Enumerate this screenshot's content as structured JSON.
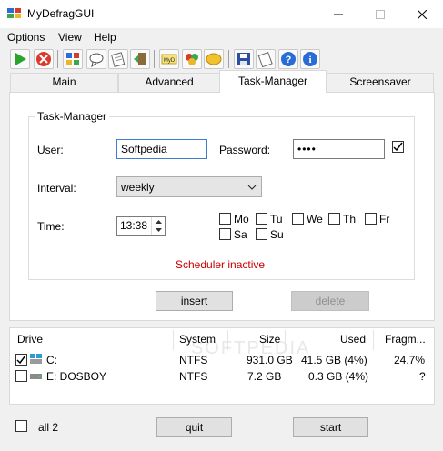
{
  "window": {
    "title": "MyDefragGUI"
  },
  "menu": {
    "items": [
      "Options",
      "View",
      "Help"
    ]
  },
  "tabs": [
    {
      "label": "Main"
    },
    {
      "label": "Advanced"
    },
    {
      "label": "Task-Manager",
      "active": true
    },
    {
      "label": "Screensaver"
    }
  ],
  "task_manager": {
    "group_label": "Task-Manager",
    "user_label": "User:",
    "user_value": "Softpedia",
    "password_label": "Password:",
    "password_value": "••••",
    "password_checked": true,
    "interval_label": "Interval:",
    "interval_value": "weekly",
    "time_label": "Time:",
    "time_value": "13:38",
    "days": [
      "Mo",
      "Tu",
      "We",
      "Th",
      "Fr",
      "Sa",
      "Su"
    ],
    "status": "Scheduler inactive",
    "status_color": "#cc0000",
    "insert_label": "insert",
    "delete_label": "delete"
  },
  "drives": {
    "columns": [
      "Drive",
      "System",
      "Size",
      "Used",
      "Fragm..."
    ],
    "rows": [
      {
        "checked": true,
        "name": "C:",
        "system": "NTFS",
        "size": "931.0 GB",
        "used": "41.5 GB (4%)",
        "fragm": "24.7%"
      },
      {
        "checked": false,
        "name": "E: DOSBOY",
        "system": "NTFS",
        "size": "7.2 GB",
        "used": "0.3 GB (4%)",
        "fragm": "?"
      }
    ],
    "watermark": "SOFTPEDIA"
  },
  "footer": {
    "all_label": "all 2",
    "quit_label": "quit",
    "start_label": "start"
  }
}
